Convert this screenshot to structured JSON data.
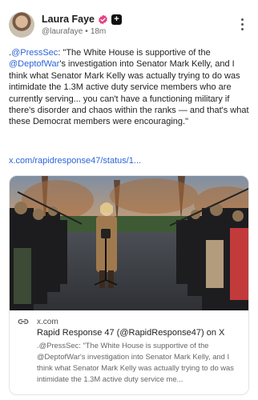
{
  "post": {
    "author": {
      "name": "Laura Faye",
      "handle": "@laurafaye",
      "separator": "•",
      "time": "18m"
    },
    "text_prefix": ".",
    "mention_1": "@PressSec",
    "text_1": ": \"The White House is supportive of the ",
    "mention_2": "@DeptofWar",
    "text_2": "'s investigation into Senator Mark Kelly, and I think what Senator Mark Kelly was actually trying to do was intimidate the 1.3M active duty service members who are currently serving... you can't have a functioning military if there's disorder and chaos within the ranks — and that's what these Democrat members were encouraging.\"",
    "link": "x.com/rapidresponse47/status/1..."
  },
  "card": {
    "domain": "x.com",
    "title": "Rapid Response 47 (@RapidResponse47) on X",
    "description": ".@PressSec: \"The White House is supportive of the @DeptofWar's investigation into Senator Mark Kelly, and I think what Senator Mark Kelly was actually trying to do was intimidate the 1.3M active duty service me..."
  },
  "icons": {
    "verified": "verified-badge-icon",
    "plus": "plus-icon",
    "more": "more-vertical-icon",
    "link": "link-icon"
  },
  "colors": {
    "accent": "#2b64d9",
    "verified": "#e3417f"
  }
}
